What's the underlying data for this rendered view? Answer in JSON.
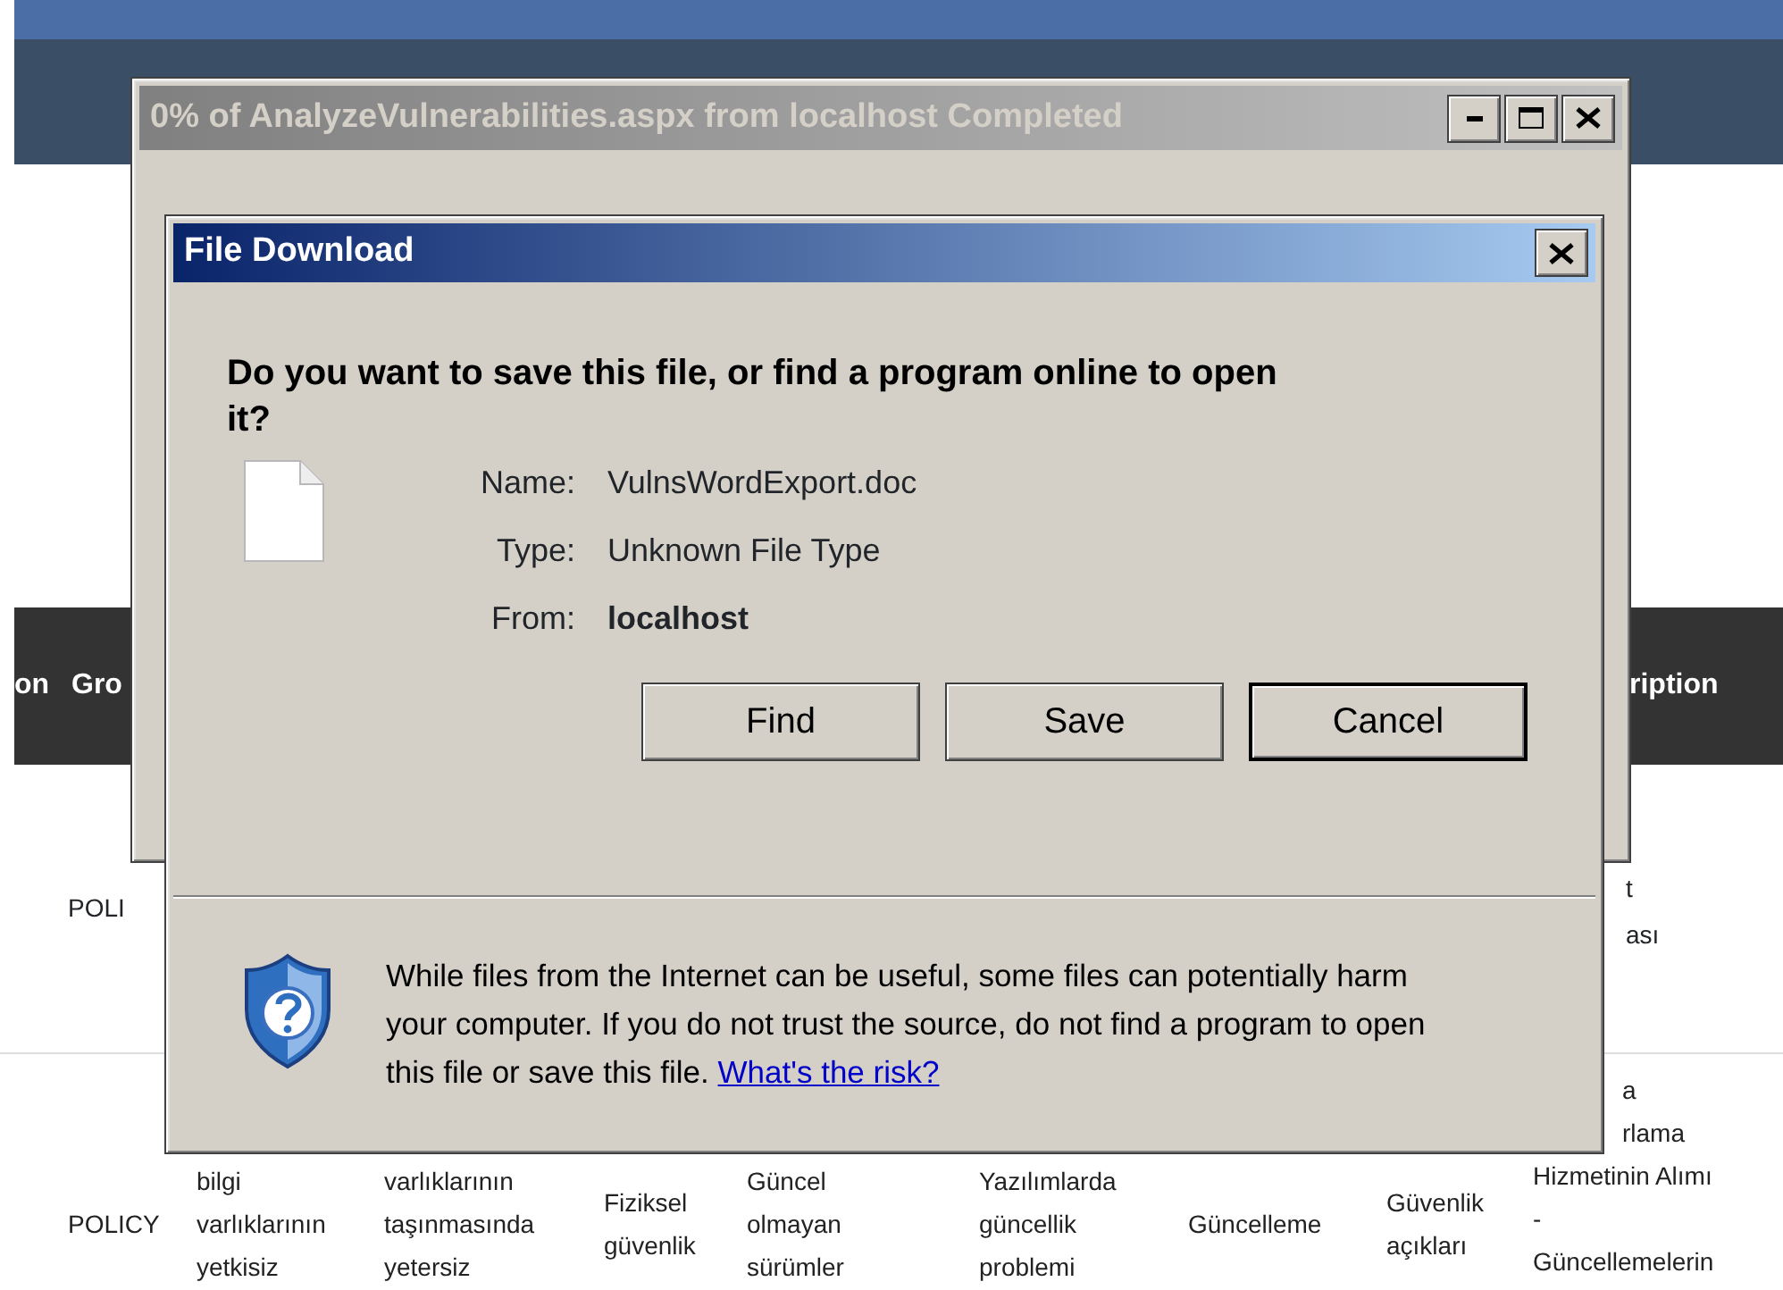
{
  "page": {
    "header_left": [
      "on",
      "Gro"
    ],
    "header_right": "ription",
    "row_1": {
      "first": "POLI",
      "last": [
        "t",
        "ası"
      ]
    },
    "row_2": [
      [
        "POLICY"
      ],
      [
        "bilgi",
        "varlıklarının",
        "yetkisiz"
      ],
      [
        "varlıklarının",
        "taşınmasında",
        "yetersiz"
      ],
      [
        "Fiziksel",
        "güvenlik"
      ],
      [
        "Güncel",
        "olmayan",
        "sürümler"
      ],
      [
        "Yazılımlarda",
        "güncellik",
        "problemi"
      ],
      [
        "Güncelleme"
      ],
      [
        "Güvenlik",
        "açıkları"
      ],
      [
        "a",
        "rlama",
        "Hizmetinin Alımı",
        "-",
        "Güncellemelerin"
      ]
    ]
  },
  "download_window": {
    "title": "0% of AnalyzeVulnerabilities.aspx from localhost Completed",
    "active": false
  },
  "dialog": {
    "title": "File Download",
    "active": true,
    "question": "Do you want to save this file, or find a program online to open it?",
    "fields": [
      {
        "label": "Name:",
        "value": "VulnsWordExport.doc",
        "emphasized": false
      },
      {
        "label": "Type:",
        "value": "Unknown File Type",
        "emphasized": false
      },
      {
        "label": "From:",
        "value": "localhost",
        "emphasized": true
      }
    ],
    "buttons": [
      {
        "label": "Find",
        "default": false
      },
      {
        "label": "Save",
        "default": false
      },
      {
        "label": "Cancel",
        "default": true
      }
    ],
    "warning": "While files from the Internet can be useful, some files can potentially harm your computer. If you do not trust the source, do not find a program to open this file or save this file.",
    "link": "What's the risk?"
  }
}
